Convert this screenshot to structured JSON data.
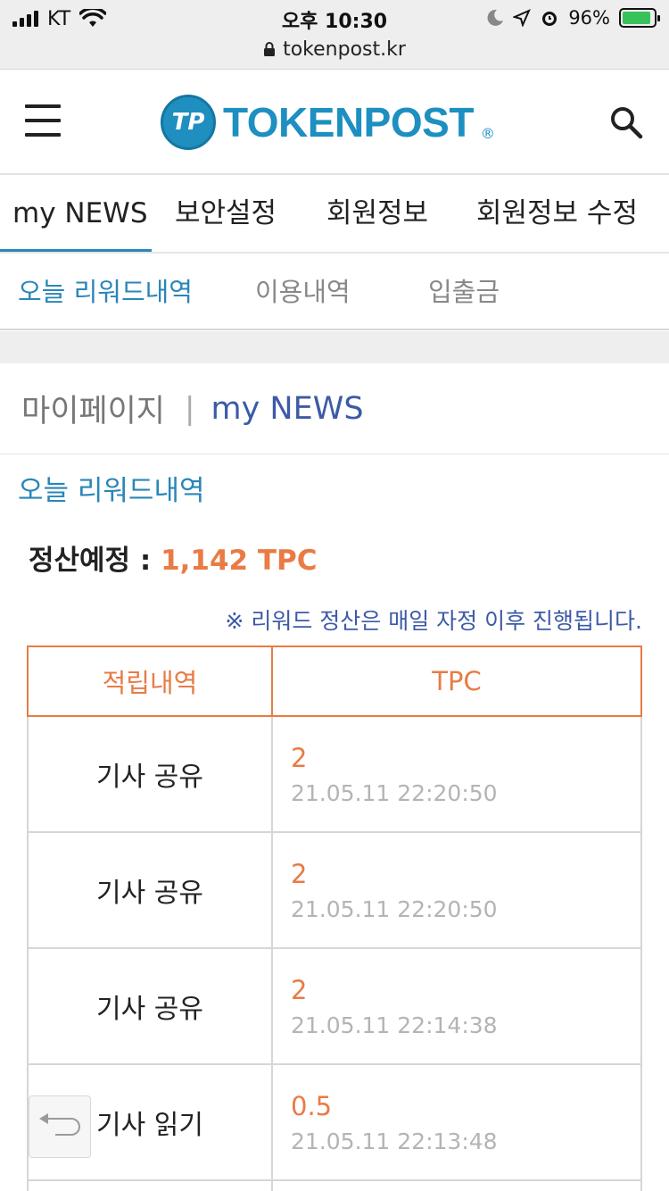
{
  "status_bar": {
    "carrier": "KT",
    "time": "오후 10:30",
    "battery": "96%"
  },
  "browser": {
    "url": "tokenpost.kr"
  },
  "header": {
    "logo_mark": "TP",
    "logo_text": "TOKENPOST",
    "logo_reg": "®"
  },
  "main_tabs": [
    "my NEWS",
    "보안설정",
    "회원정보",
    "회원정보 수정"
  ],
  "sub_tabs": [
    "오늘 리워드내역",
    "이용내역",
    "입출금"
  ],
  "breadcrumb": {
    "parent": "마이페이지",
    "separator": "|",
    "current": "my NEWS"
  },
  "section_title": "오늘 리워드내역",
  "settlement": {
    "label": "정산예정 : ",
    "amount": "1,142 TPC"
  },
  "notice": "※ 리워드 정산은 매일 자정 이후 진행됩니다.",
  "table": {
    "headers": [
      "적립내역",
      "TPC"
    ],
    "rows": [
      {
        "type": "기사 공유",
        "tpc": "2",
        "time": "21.05.11 22:20:50"
      },
      {
        "type": "기사 공유",
        "tpc": "2",
        "time": "21.05.11 22:20:50"
      },
      {
        "type": "기사 공유",
        "tpc": "2",
        "time": "21.05.11 22:14:38"
      },
      {
        "type": "기사 읽기",
        "tpc": "0.5",
        "time": "21.05.11 22:13:48"
      }
    ]
  },
  "colors": {
    "accent_blue": "#2a86b8",
    "accent_orange": "#e97b45",
    "brand": "#1d8fc0",
    "nav_blue": "#3c5aa6"
  }
}
